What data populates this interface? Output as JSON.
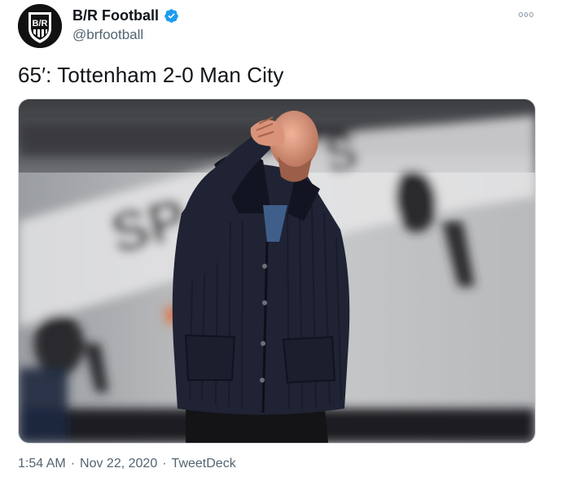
{
  "account": {
    "display_name": "B/R Football",
    "handle": "@brfootball",
    "avatar_text": "B/R",
    "verified": true
  },
  "tweet": {
    "text": "65′: Tottenham 2-0 Man City",
    "time": "1:54 AM",
    "date": "Nov 22, 2020",
    "source": "TweetDeck",
    "separator": "·"
  },
  "icons": {
    "verified": "verified-badge-icon",
    "more": "more-options-icon"
  },
  "colors": {
    "verified_blue": "#1d9bf0",
    "secondary_text": "#536471"
  }
}
